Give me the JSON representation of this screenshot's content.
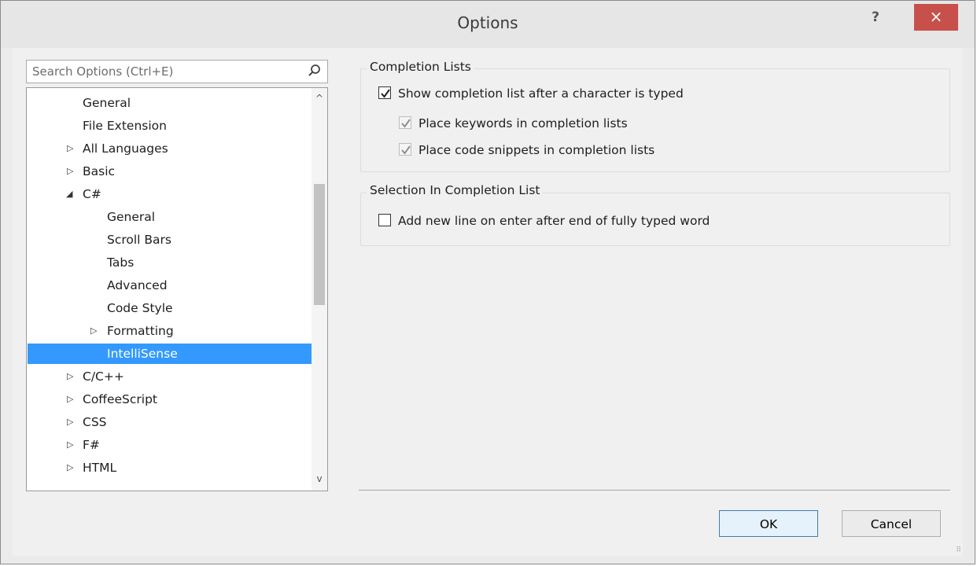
{
  "window": {
    "title": "Options",
    "help": "?",
    "close": "×"
  },
  "search": {
    "placeholder": "Search Options (Ctrl+E)"
  },
  "tree": {
    "items": [
      {
        "label": "General",
        "arrow": ""
      },
      {
        "label": "File Extension",
        "arrow": ""
      },
      {
        "label": "All Languages",
        "arrow": "▷"
      },
      {
        "label": "Basic",
        "arrow": "▷"
      },
      {
        "label": "C#",
        "arrow": "◢"
      },
      {
        "label": "General",
        "arrow": ""
      },
      {
        "label": "Scroll Bars",
        "arrow": ""
      },
      {
        "label": "Tabs",
        "arrow": ""
      },
      {
        "label": "Advanced",
        "arrow": ""
      },
      {
        "label": "Code Style",
        "arrow": ""
      },
      {
        "label": "Formatting",
        "arrow": "▷"
      },
      {
        "label": "IntelliSense",
        "arrow": "",
        "selected": true
      },
      {
        "label": "C/C++",
        "arrow": "▷"
      },
      {
        "label": "CoffeeScript",
        "arrow": "▷"
      },
      {
        "label": "CSS",
        "arrow": "▷"
      },
      {
        "label": "F#",
        "arrow": "▷"
      },
      {
        "label": "HTML",
        "arrow": "▷"
      }
    ],
    "scroll_up": "^",
    "scroll_down": "v"
  },
  "completion_lists": {
    "title": "Completion Lists",
    "show_after_char": {
      "label": "Show completion list after a character is typed",
      "checked": true
    },
    "place_keywords": {
      "label": "Place keywords in completion lists",
      "checked": true,
      "disabled": true
    },
    "place_snippets": {
      "label": "Place code snippets in completion lists",
      "checked": true,
      "disabled": true
    }
  },
  "selection": {
    "title": "Selection In Completion List",
    "add_new_line": {
      "label": "Add new line on enter after end of fully typed word",
      "checked": false
    }
  },
  "buttons": {
    "ok": "OK",
    "cancel": "Cancel"
  },
  "colors": {
    "selection": "#3399ff",
    "close": "#c7504b"
  }
}
